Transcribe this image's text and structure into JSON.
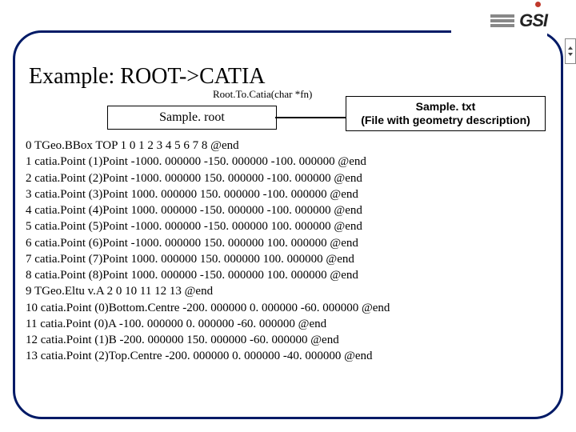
{
  "logo": {
    "text": "GSI"
  },
  "title": "Example: ROOT->CATIA",
  "func": "Root.To.Catia(char *fn)",
  "boxLeft": "Sample. root",
  "boxRight": {
    "line1": "Sample. txt",
    "line2": "(File with geometry description)"
  },
  "lines": [
    "0 TGeo.BBox TOP 1 0 1 2 3 4 5 6 7 8 @end",
    "1 catia.Point (1)Point -1000. 000000 -150. 000000 -100. 000000 @end",
    "2 catia.Point (2)Point -1000. 000000 150. 000000 -100. 000000 @end",
    "3 catia.Point (3)Point 1000. 000000 150. 000000 -100. 000000 @end",
    "4 catia.Point (4)Point 1000. 000000 -150. 000000 -100. 000000 @end",
    "5 catia.Point (5)Point -1000. 000000 -150. 000000 100. 000000 @end",
    "6 catia.Point (6)Point -1000. 000000 150. 000000 100. 000000 @end",
    "7 catia.Point (7)Point 1000. 000000 150. 000000 100. 000000 @end",
    "8 catia.Point (8)Point 1000. 000000 -150. 000000 100. 000000 @end",
    "9 TGeo.Eltu v.A 2 0 10 11 12 13 @end",
    "10 catia.Point (0)Bottom.Centre -200. 000000 0. 000000 -60. 000000 @end",
    "11 catia.Point (0)A -100. 000000 0. 000000 -60. 000000 @end",
    "12 catia.Point (1)B -200. 000000 150. 000000 -60. 000000 @end",
    "13 catia.Point (2)Top.Centre -200. 000000 0. 000000 -40. 000000 @end"
  ]
}
